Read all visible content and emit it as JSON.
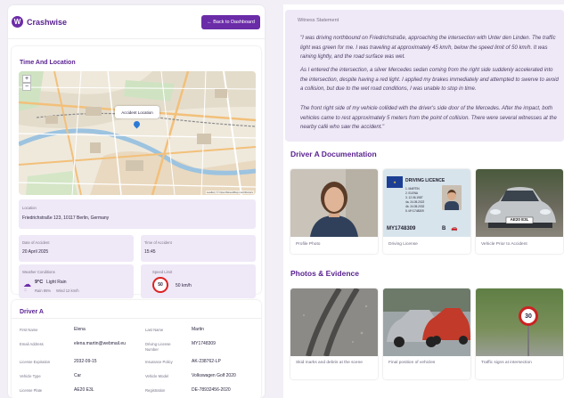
{
  "app": {
    "name": "Crashwise",
    "back_label": "← Back to Dashboard"
  },
  "time_location": {
    "title": "Time And Location",
    "map_popup": "Accident Location",
    "map_credit": "Leaflet | © OpenStreetMap contributors",
    "location_label": "Location",
    "location_value": "Friedrichstraße 123, 10117 Berlin, Germany",
    "date_label": "Date of Accident",
    "date_value": "20 April 2025",
    "time_label": "Time of Accident",
    "time_value": "15:45",
    "weather_label": "Weather Conditions",
    "weather_temp": "9°C",
    "weather_desc": "Light Rain",
    "weather_rain": "Rain 85%",
    "weather_wind": "Wind 12 km/h",
    "speed_label": "Speed Limit",
    "speed_sign": "50",
    "speed_value": "50 km/h"
  },
  "driver_a": {
    "title": "Driver A",
    "rows": [
      {
        "l1": "First Name",
        "v1": "Elena",
        "l2": "Last Name",
        "v2": "Martin"
      },
      {
        "l1": "Email Address",
        "v1": "elena.martin@webmail.eu",
        "l2": "Driving License Number",
        "v2": "MY1748309"
      },
      {
        "l1": "License Expiration",
        "v1": "2032-09-15",
        "l2": "Insurance Policy",
        "v2": "AK-238762-LP"
      },
      {
        "l1": "Vehicle Type",
        "v1": "Car",
        "l2": "Vehicle Model",
        "v2": "Volkswagen Golf 2020"
      },
      {
        "l1": "License Plate",
        "v1": "AE20 E3L",
        "l2": "Registration",
        "v2": "DE-78932456-2020"
      }
    ]
  },
  "witness": {
    "label": "Witness Statement",
    "p1": "\"I was driving northbound on Friedrichstraße, approaching the intersection with Unter den Linden. The traffic light was green for me. I was traveling at approximately 45 km/h, below the speed limit of 50 km/h. It was raining lightly, and the road surface was wet.",
    "p2": "As I entered the intersection, a silver Mercedes sedan coming from the right side suddenly accelerated into the intersection, despite having a red light. I applied my brakes immediately and attempted to swerve to avoid a collision, but due to the wet road conditions, I was unable to stop in time.",
    "p3": "The front right side of my vehicle collided with the driver's side door of the Mercedes. After the impact, both vehicles came to rest approximately 5 meters from the point of collision. There were several witnesses at the nearby café who saw the accident.\""
  },
  "driver_a_docs": {
    "title": "Driver A Documentation",
    "items": [
      "Profile Photo",
      "Driving License",
      "Vehicle Prior to Accident"
    ],
    "licence": {
      "heading": "DRIVING LICENCE",
      "l1": "1. MARTIN",
      "l2": "2. ELENA",
      "l3": "3. 12.06.1987",
      "l4": "4a. 24.05.2022",
      "l5": "4b. 24.05.2032",
      "l6": "5. MY1748309",
      "number": "MY1748309",
      "cat": "B"
    },
    "plate": "AE20 E3L"
  },
  "evidence": {
    "title": "Photos & Evidence",
    "items": [
      "Skid marks and debris at the scene",
      "Final position of vehicles",
      "Traffic signs at intersection"
    ],
    "sign": "30"
  },
  "colors": {
    "accent": "#6b2ca8",
    "panel": "#efe8f7"
  }
}
